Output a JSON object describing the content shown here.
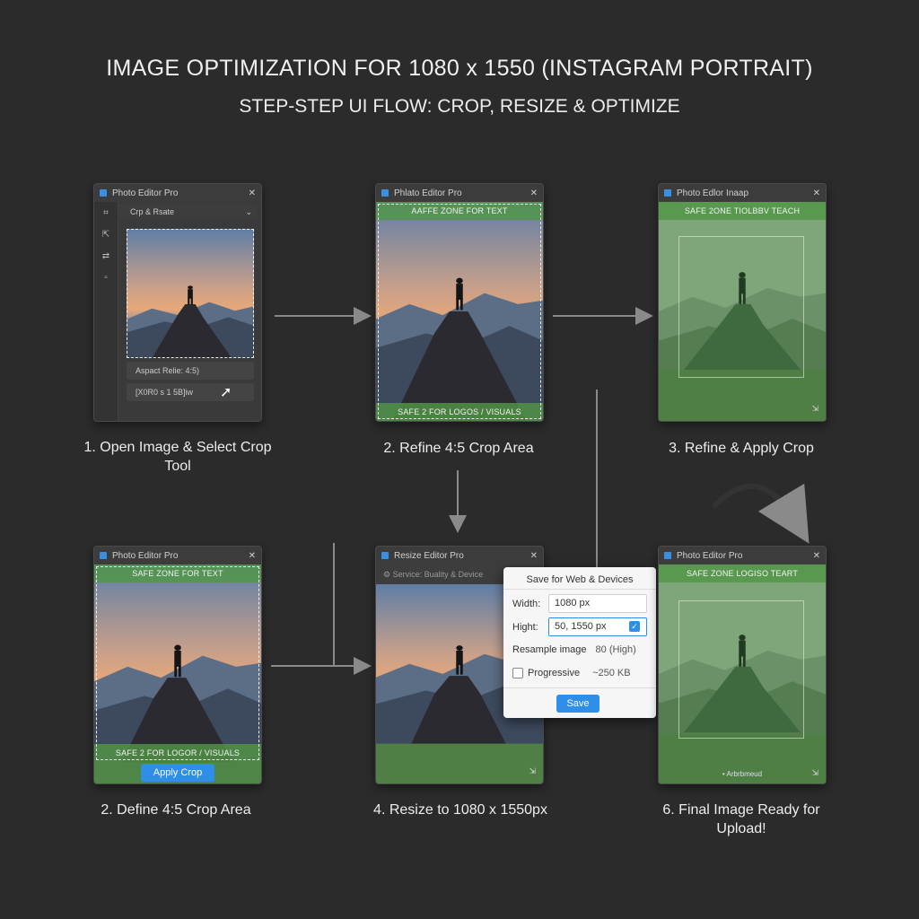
{
  "header": {
    "title": "IMAGE OPTIMIZATION FOR 1080 x 1550 (INSTAGRAM PORTRAIT)",
    "subtitle": "STEP-STEP UI FLOW: CROP, RESIZE & OPTIMIZE"
  },
  "colors": {
    "background": "#2b2b2b",
    "safe_zone": "#5a9a4a",
    "accent": "#2f8fe8"
  },
  "panels": [
    {
      "title": "Photo Editor Pro",
      "menu": "Crp & Rsate",
      "aspect_field": "Aspact Relie: 4:5)",
      "size_field": "[X0R0 s 1 5B]iw",
      "caption": "1. Open Image & Select Crop Tool"
    },
    {
      "title": "Phlato Editor Pro",
      "top_band": "AAFFE ZONE FOR TEXT",
      "bottom_band": "SAFE 2 FOR LOGOS / VISUALS",
      "caption": "2. Refine 4:5 Crop Area"
    },
    {
      "title": "Photo Edlor Inaap",
      "top_band": "SAFE 2ONE TIOLBBV TEACH",
      "caption": "3. Refine & Apply Crop"
    },
    {
      "title": "Photo Editor Pro",
      "top_band": "SAFE ZONE FOR TEXT",
      "bottom_band": "SAFE 2 FOR LOGOR / VISUALS",
      "button": "Apply Crop",
      "caption": "2. Define 4:5 Crop Area"
    },
    {
      "title": "Resize Editor Pro",
      "menu": "Service: Buality & Device",
      "caption": "4. Resize to 1080 x 1550px"
    },
    {
      "title": "Photo Editor Pro",
      "top_band": "SAFE ZONE LOGISO TEART",
      "footer_text": "• Arbrbmeud",
      "caption": "6. Final Image Ready for Upload!"
    }
  ],
  "dialog": {
    "title": "Save for Web & Devices",
    "width_label": "Width:",
    "width_value": "1080 px",
    "height_label": "Hight:",
    "height_value": "50, 1550 px",
    "resample_label": "Resample image",
    "resample_value": "80 (High)",
    "progressive_label": "Progressive",
    "progressive_value": "~250 KB",
    "save_label": "Save"
  }
}
